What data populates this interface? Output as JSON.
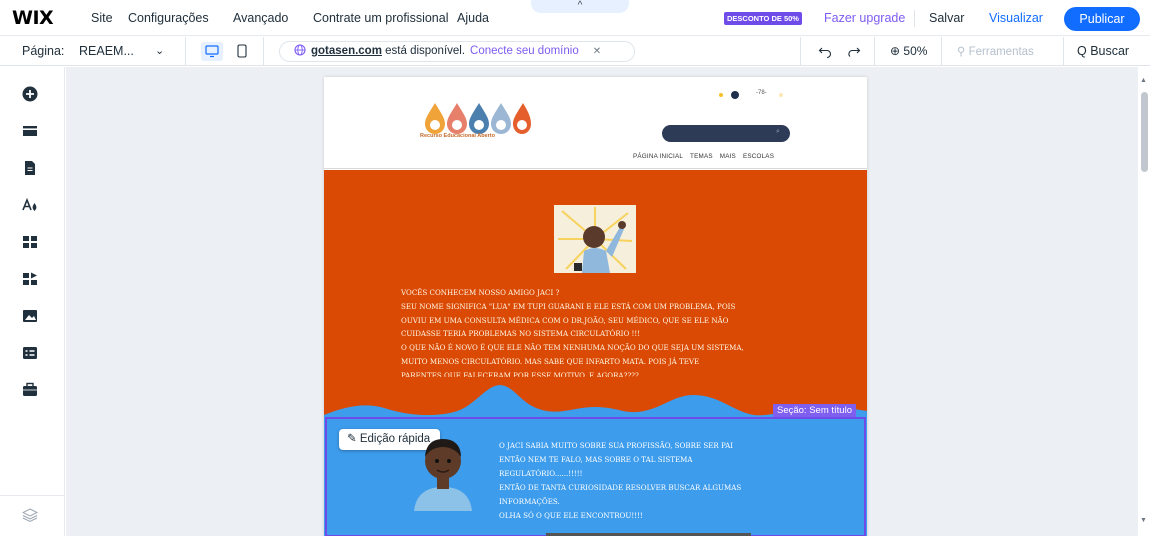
{
  "topbar": {
    "logo": "WIX",
    "menu": [
      "Site",
      "Configurações",
      "Avançado",
      "Contrate um profissional",
      "Ajuda"
    ],
    "collapse_glyph": "^",
    "discount_badge": "DESCONTO DE 50%",
    "upgrade": "Fazer upgrade",
    "save": "Salvar",
    "preview": "Visualizar",
    "publish": "Publicar",
    "colors": {
      "accent": "#116dff",
      "premium": "#6f4ce8"
    }
  },
  "toolbar": {
    "page_label": "Página:",
    "page_value": "REAEM...",
    "page_chevron": "⌄",
    "domain_name": "gotasen.com",
    "domain_rest": " está disponível.",
    "domain_connect": "Conecte seu domínio",
    "domain_close": "✕",
    "zoom": "⊕ 50%",
    "tools": "⚲ Ferramentas",
    "search": "Q  Buscar"
  },
  "leftrail": {
    "icons": [
      "add-icon",
      "menus-icon",
      "pages-icon",
      "design-icon",
      "apps-icon",
      "business-apps-icon",
      "media-icon",
      "cms-icon",
      "portfolio-icon",
      "layers-icon"
    ]
  },
  "site": {
    "logo_subtitle": "Recurso Educacional Aberto",
    "header_temp": "-78-",
    "nav": [
      "PÁGINA INICIAL",
      "TEMAS",
      "MAIS",
      "ESCOLAS"
    ],
    "story_lines": [
      "VOCÊS CONHECEM NOSSO AMIGO JACI ?",
      "   SEU NOME SIGNIFICA \"LUA\" EM TUPI GUARANI E ELE ESTÁ COM UM PROBLEMA, POIS",
      "OUVIU EM UMA CONSULTA MÉDICA COM O DR.JOÃO, SEU MÉDICO, QUE SE ELE NÃO",
      "CUIDASSE TERIA PROBLEMAS NO SISTEMA CIRCULATÓRIO !!!",
      "O QUE NÃO É NOVO É QUE ELE NÃO TEM NENHUMA NOÇÃO DO QUE SEJA UM SISTEMA,",
      "MUITO MENOS CIRCULATÓRIO. MAS SABE QUE INFARTO MATA. POIS JÁ TEVE",
      "PARENTES QUE FALECERAM POR ESSE MOTIVO. E AGORA????"
    ],
    "blue_lines": [
      "O JACI SABIA MUITO SOBRE SUA PROFISSÃO, SOBRE SER PAI",
      "ENTÃO NEM TE FALO, MAS SOBRE O TAL SISTEMA",
      "REGULATÓRIO......!!!!!",
      "ENTÃO DE TANTA CURIOSIDADE RESOLVER BUSCAR ALGUMAS",
      "INFORMAÇÕES.",
      "OLHA SÓ O QUE ELE ENCONTROU!!!!"
    ],
    "quick_edit": "Edição rápida",
    "section_tag": "Seção: Sem título",
    "colors": {
      "orange": "#da4a04",
      "blue": "#3d9cec"
    }
  }
}
